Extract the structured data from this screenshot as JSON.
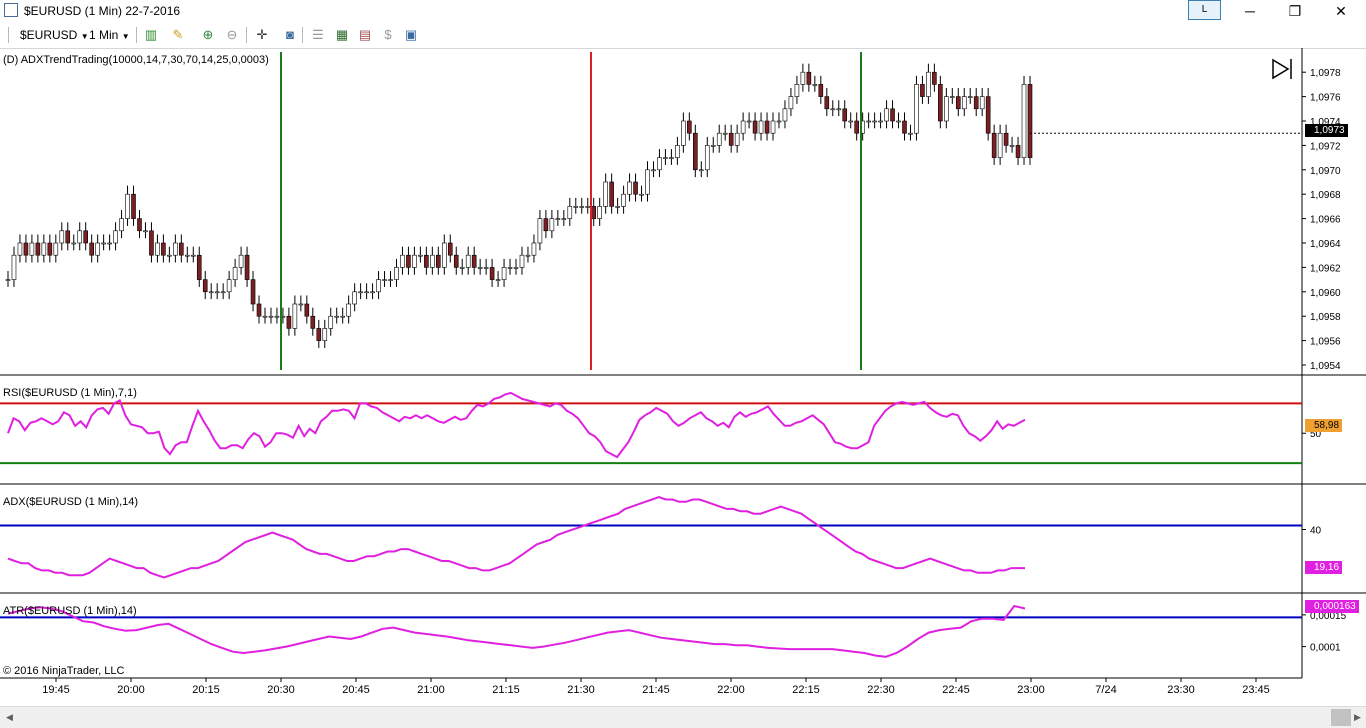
{
  "window": {
    "title": "$EURUSD (1 Min)  22-7-2016",
    "l_button": "L",
    "minimize": "─",
    "maximize": "❐",
    "close": "✕"
  },
  "toolbar": {
    "instrument": "$EURUSD",
    "interval": "1 Min"
  },
  "panels": {
    "price_label": "(D) ADXTrendTrading(10000,14,7,30,70,14,25,0,0003)",
    "rsi_label": "RSI($EURUSD (1 Min),7,1)",
    "adx_label": "ADX($EURUSD (1 Min),14)",
    "atr_label": "ATR($EURUSD (1 Min),14)",
    "copyright": "© 2016 NinjaTrader, LLC"
  },
  "axes": {
    "price_ticks": [
      "1,0978",
      "1,0976",
      "1,0974",
      "1,0972",
      "1,0970",
      "1,0968",
      "1,0966",
      "1,0964",
      "1,0962",
      "1,0960",
      "1,0958",
      "1,0956",
      "1,0954"
    ],
    "price_current": "1,0973",
    "rsi_tick": "50",
    "rsi_current": "58,98",
    "adx_tick": "40",
    "adx_current": "19,16",
    "atr_ticks": [
      "0,00015",
      "0,0001"
    ],
    "atr_current": "0,000163",
    "time_ticks": [
      "19:45",
      "20:00",
      "20:15",
      "20:30",
      "20:45",
      "21:00",
      "21:15",
      "21:30",
      "21:45",
      "22:00",
      "22:15",
      "22:30",
      "22:45",
      "23:00",
      "7/24",
      "23:30",
      "23:45"
    ]
  },
  "colors": {
    "up_candle": "#ffffff",
    "down_candle": "#7a1f24",
    "buy_line": "#1a7a1a",
    "sell_line": "#e02020",
    "indicator": "#e020e0",
    "rsi_upper": "#d01010",
    "rsi_lower": "#108010",
    "level_line": "#0000c0"
  },
  "chart_data": [
    {
      "type": "candlestick",
      "title": "(D) ADXTrendTrading(10000,14,7,30,70,14,25,0,0003)",
      "ylim": [
        1.0954,
        1.0979
      ],
      "closes": [
        1.0961,
        1.0963,
        1.0964,
        1.0963,
        1.0964,
        1.0963,
        1.0964,
        1.0963,
        1.0964,
        1.0965,
        1.0964,
        1.0964,
        1.0965,
        1.0964,
        1.0963,
        1.0964,
        1.0964,
        1.0964,
        1.0965,
        1.0966,
        1.0968,
        1.0966,
        1.0965,
        1.0965,
        1.0963,
        1.0964,
        1.0963,
        1.0963,
        1.0964,
        1.0963,
        1.0963,
        1.0963,
        1.0961,
        1.096,
        1.096,
        1.096,
        1.096,
        1.0961,
        1.0962,
        1.0963,
        1.0961,
        1.0959,
        1.0958,
        1.0958,
        1.0958,
        1.0958,
        1.0958,
        1.0957,
        1.0959,
        1.0959,
        1.0958,
        1.0957,
        1.0956,
        1.0957,
        1.0958,
        1.0958,
        1.0958,
        1.0959,
        1.096,
        1.096,
        1.096,
        1.096,
        1.0961,
        1.0961,
        1.0961,
        1.0962,
        1.0963,
        1.0962,
        1.0963,
        1.0963,
        1.0962,
        1.0963,
        1.0962,
        1.0964,
        1.0963,
        1.0962,
        1.0962,
        1.0963,
        1.0962,
        1.0962,
        1.0962,
        1.0961,
        1.0961,
        1.0962,
        1.0962,
        1.0962,
        1.0963,
        1.0963,
        1.0964,
        1.0966,
        1.0965,
        1.0966,
        1.0966,
        1.0966,
        1.0967,
        1.0967,
        1.0967,
        1.0967,
        1.0966,
        1.0967,
        1.0969,
        1.0967,
        1.0967,
        1.0968,
        1.0969,
        1.0968,
        1.0968,
        1.097,
        1.097,
        1.0971,
        1.0971,
        1.0971,
        1.0972,
        1.0974,
        1.0973,
        1.097,
        1.097,
        1.0972,
        1.0972,
        1.0973,
        1.0973,
        1.0972,
        1.0973,
        1.0974,
        1.0974,
        1.0973,
        1.0974,
        1.0973,
        1.0974,
        1.0974,
        1.0975,
        1.0976,
        1.0977,
        1.0978,
        1.0977,
        1.0977,
        1.0976,
        1.0975,
        1.0975,
        1.0975,
        1.0974,
        1.0974,
        1.0973,
        1.0974,
        1.0974,
        1.0974,
        1.0974,
        1.0975,
        1.0974,
        1.0974,
        1.0973,
        1.0973,
        1.0977,
        1.0976,
        1.0978,
        1.0977,
        1.0974,
        1.0976,
        1.0976,
        1.0975,
        1.0976,
        1.0976,
        1.0975,
        1.0976,
        1.0973,
        1.0971,
        1.0973,
        1.0972,
        1.0972,
        1.0971,
        1.0977,
        1.0971
      ],
      "signals": [
        {
          "time": "20:30",
          "type": "buy"
        },
        {
          "time": "21:32",
          "type": "sell"
        },
        {
          "time": "22:26",
          "type": "buy"
        }
      ]
    },
    {
      "type": "line",
      "title": "RSI($EURUSD (1 Min),7,1)",
      "levels": [
        70,
        30
      ],
      "ylim": [
        20,
        85
      ],
      "series": [
        {
          "name": "RSI($EURUSD (1 Min),7,1)",
          "values": [
            50,
            60,
            58,
            52,
            57,
            58,
            60,
            58,
            56,
            58,
            64,
            62,
            55,
            58,
            54,
            62,
            66,
            67,
            63,
            70,
            72,
            62,
            56,
            55,
            54,
            50,
            50,
            51,
            40,
            36,
            42,
            44,
            44,
            55,
            65,
            58,
            52,
            45,
            40,
            40,
            42,
            42,
            40,
            46,
            50,
            48,
            41,
            44,
            50,
            50,
            49,
            47,
            55,
            48,
            53,
            50,
            58,
            61,
            65,
            65,
            66,
            65,
            60,
            70,
            70,
            68,
            67,
            64,
            62,
            60,
            58,
            61,
            60,
            62,
            60,
            62,
            60,
            58,
            57,
            59,
            61,
            59,
            60,
            65,
            69,
            68,
            70,
            73,
            74,
            76,
            77,
            75,
            73,
            72,
            71,
            70,
            69,
            68,
            70,
            69,
            65,
            63,
            60,
            55,
            50,
            48,
            44,
            38,
            36,
            34,
            39,
            44,
            51,
            59,
            62,
            64,
            67,
            65,
            63,
            58,
            55,
            57,
            60,
            62,
            64,
            60,
            58,
            55,
            57,
            54,
            61,
            64,
            61,
            63,
            64,
            66,
            68,
            63,
            59,
            55,
            55,
            57,
            58,
            60,
            62,
            59,
            56,
            50,
            44,
            43,
            41,
            40,
            40,
            42,
            44,
            55,
            60,
            65,
            68,
            70,
            71,
            70,
            69,
            70,
            71,
            67,
            64,
            62,
            61,
            63,
            62,
            55,
            50,
            48,
            45,
            48,
            52,
            58,
            53,
            56,
            55,
            57,
            59
          ]
        }
      ]
    },
    {
      "type": "line",
      "title": "ADX($EURUSD (1 Min),14)",
      "levels": [
        40
      ],
      "ylim": [
        14,
        55
      ],
      "series": [
        {
          "name": "ADX($EURUSD (1 Min),14)",
          "values": [
            26,
            25,
            24,
            24,
            22,
            21,
            21,
            20,
            20,
            19,
            19,
            19,
            20,
            22,
            24,
            26,
            25,
            24,
            23,
            22,
            22,
            20,
            19,
            18,
            19,
            20,
            21,
            22,
            22,
            23,
            24,
            25,
            27,
            29,
            31,
            33,
            34,
            35,
            36,
            37,
            36,
            35,
            34,
            32,
            30,
            29,
            28,
            28,
            27,
            26,
            25,
            25,
            26,
            27,
            27,
            28,
            29,
            29,
            30,
            30,
            29,
            28,
            27,
            26,
            25,
            25,
            24,
            23,
            22,
            22,
            21,
            21,
            22,
            23,
            24,
            26,
            28,
            30,
            32,
            33,
            34,
            36,
            37,
            38,
            39,
            40,
            41,
            42,
            43,
            44,
            45,
            47,
            48,
            49,
            50,
            51,
            52,
            51,
            51,
            50,
            50,
            51,
            51,
            50,
            49,
            48,
            47,
            47,
            46,
            46,
            45,
            45,
            46,
            47,
            48,
            47,
            46,
            45,
            43,
            41,
            39,
            37,
            35,
            33,
            31,
            29,
            28,
            26,
            25,
            24,
            23,
            22,
            22,
            23,
            24,
            25,
            26,
            25,
            24,
            23,
            22,
            21,
            21,
            20,
            20,
            20,
            21,
            21,
            22,
            22,
            22
          ]
        }
      ]
    },
    {
      "type": "line",
      "title": "ATR($EURUSD (1 Min),14)",
      "levels": [
        0.000146
      ],
      "ylim": [
        6e-05,
        0.000175
      ],
      "series": [
        {
          "name": "ATR($EURUSD (1 Min),14)",
          "values": [
            0.000152,
            0.000156,
            0.00016,
            0.000162,
            0.00016,
            0.000156,
            0.000148,
            0.00014,
            0.000138,
            0.000132,
            0.000128,
            0.000125,
            0.000126,
            0.00013,
            0.000134,
            0.000136,
            0.000128,
            0.00012,
            0.000112,
            0.000104,
            9.8e-05,
            9.2e-05,
            9e-05,
            9.2e-05,
            9.4e-05,
            9.7e-05,
            0.0001,
            0.000104,
            0.000108,
            0.000112,
            0.000116,
            0.000114,
            0.000112,
            0.000116,
            0.000122,
            0.000128,
            0.00013,
            0.000126,
            0.000122,
            0.00012,
            0.000118,
            0.000116,
            0.000113,
            0.00011,
            0.000108,
            0.000106,
            0.000104,
            0.000102,
            0.0001,
            9.8e-05,
            0.0001,
            0.000103,
            0.000106,
            0.00011,
            0.000114,
            0.000118,
            0.000122,
            0.000124,
            0.000126,
            0.000122,
            0.000118,
            0.000114,
            0.000112,
            0.00011,
            0.000108,
            0.000106,
            0.000104,
            0.000104,
            0.000102,
            0.000102,
            0.0001,
            9.8e-05,
            9.7e-05,
            9.6e-05,
            9.6e-05,
            9.6e-05,
            9.6e-05,
            9.6e-05,
            9.4e-05,
            9.2e-05,
            9e-05,
            8.6e-05,
            8.4e-05,
            9e-05,
            0.0001,
            0.000112,
            0.000122,
            0.000126,
            0.000128,
            0.00013,
            0.00014,
            0.000144,
            0.000144,
            0.000142,
            0.000164,
            0.00016
          ]
        }
      ]
    }
  ]
}
